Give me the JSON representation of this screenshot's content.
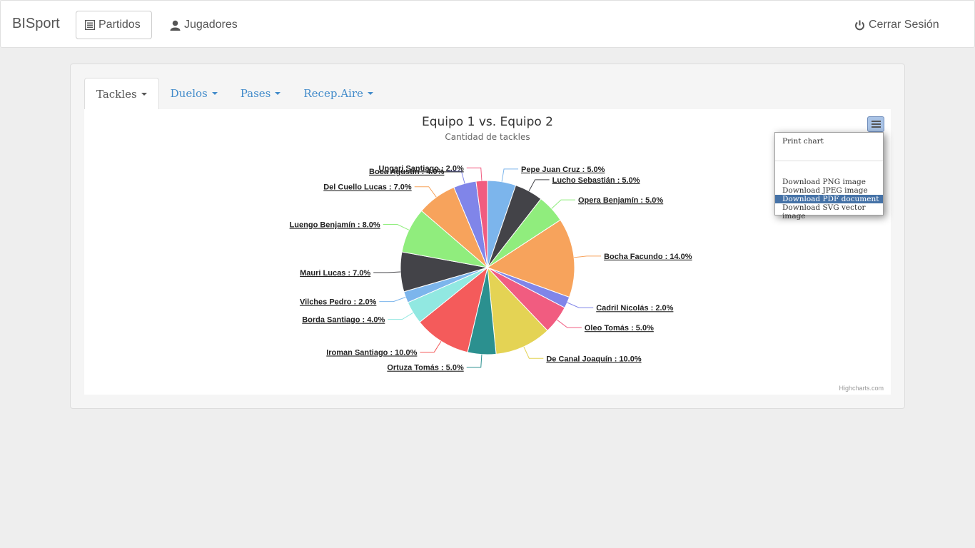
{
  "navbar": {
    "brand": "BISport",
    "partidos_label": "Partidos",
    "jugadores_label": "Jugadores",
    "logout_label": "Cerrar Sesión"
  },
  "tabs": [
    {
      "label": "Tackles",
      "active": true
    },
    {
      "label": "Duelos",
      "active": false
    },
    {
      "label": "Pases",
      "active": false
    },
    {
      "label": "Recep.Aire",
      "active": false
    }
  ],
  "export_menu": {
    "print": "Print chart",
    "png": "Download PNG image",
    "jpeg": "Download JPEG image",
    "pdf": "Download PDF document",
    "svg": "Download SVG vector image",
    "highlighted": "pdf"
  },
  "credits": "Highcharts.com",
  "chart_data": {
    "type": "pie",
    "title": "Equipo 1 vs. Equipo 2",
    "subtitle": "Cantidad de tackles",
    "slices": [
      {
        "name": "Pepe Juan Cruz",
        "value": 5.0,
        "color": "#7cb5ec"
      },
      {
        "name": "Lucho Sebastián",
        "value": 5.0,
        "color": "#434348"
      },
      {
        "name": "Opera Benjamín",
        "value": 5.0,
        "color": "#90ed7d"
      },
      {
        "name": "Bocha Facundo",
        "value": 14.0,
        "color": "#f7a35c"
      },
      {
        "name": "Cadril Nicolás",
        "value": 2.0,
        "color": "#8085e9"
      },
      {
        "name": "Oleo Tomás",
        "value": 5.0,
        "color": "#f15c80"
      },
      {
        "name": "De Canal Joaquín",
        "value": 10.0,
        "color": "#e4d354"
      },
      {
        "name": "Ortuza Tomás",
        "value": 5.0,
        "color": "#2b908f"
      },
      {
        "name": "Iroman Santiago",
        "value": 10.0,
        "color": "#f45b5b"
      },
      {
        "name": "Borda Santiago",
        "value": 4.0,
        "color": "#91e8e1"
      },
      {
        "name": "Vilches Pedro",
        "value": 2.0,
        "color": "#7cb5ec"
      },
      {
        "name": "Mauri Lucas",
        "value": 7.0,
        "color": "#434348"
      },
      {
        "name": "Luengo Benjamín",
        "value": 8.0,
        "color": "#90ed7d"
      },
      {
        "name": "Del Cuello Lucas",
        "value": 7.0,
        "color": "#f7a35c"
      },
      {
        "name": "Boca Agustín",
        "value": 4.0,
        "color": "#8085e9"
      },
      {
        "name": "Ungari Santiago",
        "value": 2.0,
        "color": "#f15c80"
      }
    ]
  }
}
